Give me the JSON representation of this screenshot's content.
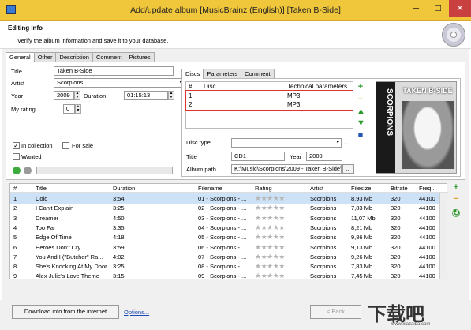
{
  "window": {
    "title": "Add/update album [MusicBrainz (English)] [Taken B-Side]",
    "min": "─",
    "max": "☐",
    "close": "✕"
  },
  "header": {
    "title": "Editing Info",
    "subtitle": "Verify the album information and save it to your database."
  },
  "tabs": [
    "General",
    "Other",
    "Description",
    "Comment",
    "Pictures"
  ],
  "form": {
    "title_label": "Title",
    "title_value": "Taken B-Side",
    "artist_label": "Artist",
    "artist_value": "Scorpions",
    "year_label": "Year",
    "year_value": "2009",
    "duration_label": "Duration",
    "duration_value": "01:15:13",
    "rating_label": "My rating",
    "rating_value": "0",
    "in_collection": "In collection",
    "for_sale": "For sale",
    "wanted": "Wanted"
  },
  "disc_tabs": [
    "Discs",
    "Parameters",
    "Comment"
  ],
  "discs": {
    "headers": [
      "#",
      "Disc",
      "Technical parameters"
    ],
    "rows": [
      {
        "num": "1",
        "disc": "",
        "params": "MP3"
      },
      {
        "num": "2",
        "disc": "",
        "params": "MP3"
      }
    ],
    "disc_type_label": "Disc type",
    "title_label": "Title",
    "title_value": "CD1",
    "year_label": "Year",
    "year_value": "2009",
    "path_label": "Album path",
    "path_value": "K:\\Music\\Scorpions\\2009 - Taken B-Side\\",
    "browse": "...",
    "dots": "..."
  },
  "cover": {
    "band": "SCORPIONS",
    "title": "TAKEN B-SIDE"
  },
  "tracks": {
    "headers": [
      "#",
      "Title",
      "Duration",
      "Filename",
      "Rating",
      "Artist",
      "Filesize",
      "Bitrate",
      "Freq..."
    ],
    "rows": [
      {
        "n": "1",
        "t": "Cold",
        "d": "3:54",
        "f": "01 - Scorpions - ...",
        "a": "Scorpions",
        "s": "8,93 Mb",
        "b": "320",
        "q": "44100"
      },
      {
        "n": "2",
        "t": "I Can't Explain",
        "d": "3:25",
        "f": "02 - Scorpions - ...",
        "a": "Scorpions",
        "s": "7,83 Mb",
        "b": "320",
        "q": "44100"
      },
      {
        "n": "3",
        "t": "Dreamer",
        "d": "4:50",
        "f": "03 - Scorpions - ...",
        "a": "Scorpions",
        "s": "11,07 Mb",
        "b": "320",
        "q": "44100"
      },
      {
        "n": "4",
        "t": "Too Far",
        "d": "3:35",
        "f": "04 - Scorpions - ...",
        "a": "Scorpions",
        "s": "8,21 Mb",
        "b": "320",
        "q": "44100"
      },
      {
        "n": "5",
        "t": "Edge Of Time",
        "d": "4:18",
        "f": "05 - Scorpions - ...",
        "a": "Scorpions",
        "s": "9,86 Mb",
        "b": "320",
        "q": "44100"
      },
      {
        "n": "6",
        "t": "Heroes Don't Cry",
        "d": "3:59",
        "f": "06 - Scorpions - ...",
        "a": "Scorpions",
        "s": "9,13 Mb",
        "b": "320",
        "q": "44100"
      },
      {
        "n": "7",
        "t": "You And I (\"Butcher\" Ra...",
        "d": "4:02",
        "f": "07 - Scorpions - ...",
        "a": "Scorpions",
        "s": "9,26 Mb",
        "b": "320",
        "q": "44100"
      },
      {
        "n": "8",
        "t": "She's Knocking At My Door",
        "d": "3:25",
        "f": "08 - Scorpions - ...",
        "a": "Scorpions",
        "s": "7,83 Mb",
        "b": "320",
        "q": "44100"
      },
      {
        "n": "9",
        "t": "Alex Julie's Love Theme",
        "d": "3:15",
        "f": "09 - Scorpions - ...",
        "a": "Scorpions",
        "s": "7,45 Mb",
        "b": "320",
        "q": "44100"
      }
    ],
    "stars": "★★★★★"
  },
  "footer": {
    "download": "Download info from the internet",
    "options": "Options...",
    "back": "< Back",
    "watermark": "下载吧",
    "watermark_url": "www.xiazaiba.com"
  }
}
